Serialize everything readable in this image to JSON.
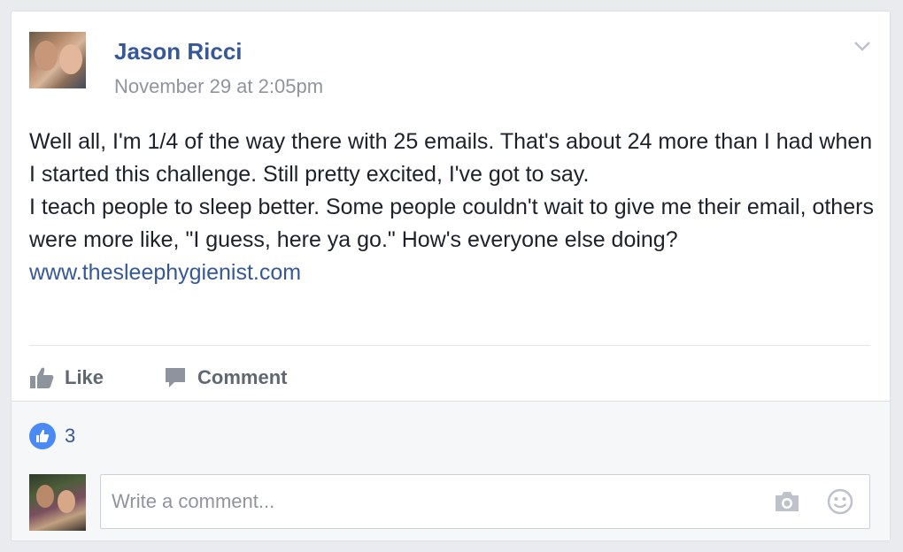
{
  "post": {
    "author": "Jason Ricci",
    "timestamp": "November 29 at 2:05pm",
    "paragraph1": "Well all, I'm 1/4 of the way there with 25 emails. That's about 24 more than I had when I started this challenge. Still pretty excited, I've got to say.",
    "paragraph2": "I teach people to sleep better. Some people couldn't wait to give me their email, others were more like, \"I guess, here ya go.\" How's everyone else doing?",
    "link": "www.thesleephygienist.com"
  },
  "actions": {
    "like_label": "Like",
    "comment_label": "Comment"
  },
  "reactions": {
    "count": "3"
  },
  "comment": {
    "placeholder": "Write a comment..."
  },
  "icons": {
    "menu": "chevron-down-icon",
    "like": "thumbs-up-icon",
    "comment": "speech-bubble-icon",
    "reaction": "like-reaction-icon",
    "camera": "camera-icon",
    "emoji": "smiley-icon"
  },
  "colors": {
    "link": "#365899",
    "muted": "#90949c",
    "action": "#606770",
    "like_badge": "#4a8af4",
    "background": "#e9ebee"
  }
}
